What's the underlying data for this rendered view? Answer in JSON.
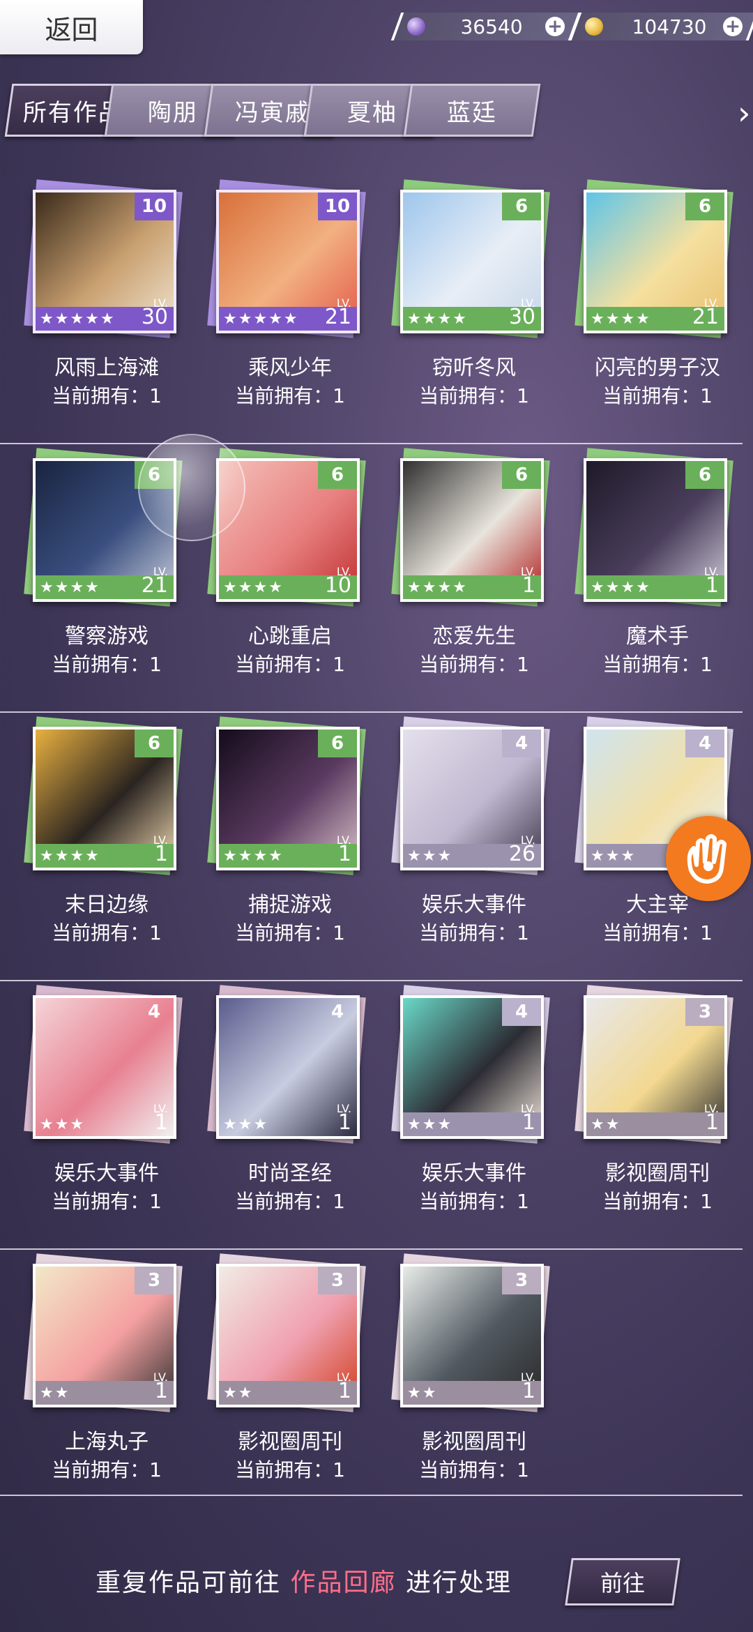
{
  "topbar": {
    "back_label": "返回",
    "gem_value": "36540",
    "coin_value": "104730"
  },
  "tabs": [
    "所有作品",
    "陶朋",
    "冯寅戚",
    "夏柚",
    "蓝廷"
  ],
  "active_tab": 0,
  "cards": [
    {
      "name": "风雨上海滩",
      "owned": "当前拥有：1",
      "count": "10",
      "stars": "★★★★★",
      "lv": "30",
      "tier": "t10",
      "colors": [
        "#3a2a1a",
        "#c9a070",
        "#f0e4d0"
      ]
    },
    {
      "name": "乘风少年",
      "owned": "当前拥有：1",
      "count": "10",
      "stars": "★★★★★",
      "lv": "21",
      "tier": "t10",
      "colors": [
        "#d8703a",
        "#f2b080",
        "#e25a4a"
      ]
    },
    {
      "name": "窃听冬风",
      "owned": "当前拥有：1",
      "count": "6",
      "stars": "★★★★",
      "lv": "30",
      "tier": "t6",
      "colors": [
        "#9ec6ec",
        "#e8eef6",
        "#c6d6e8"
      ]
    },
    {
      "name": "闪亮的男子汉",
      "owned": "当前拥有：1",
      "count": "6",
      "stars": "★★★★",
      "lv": "21",
      "tier": "t6",
      "colors": [
        "#5ec4e8",
        "#f4e0a0",
        "#e8c070"
      ]
    },
    {
      "name": "警察游戏",
      "owned": "当前拥有：1",
      "count": "6",
      "stars": "★★★★",
      "lv": "21",
      "tier": "t6",
      "colors": [
        "#1a2440",
        "#3a4f80",
        "#c8ccd8"
      ]
    },
    {
      "name": "心跳重启",
      "owned": "当前拥有：1",
      "count": "6",
      "stars": "★★★★",
      "lv": "10",
      "tier": "t6",
      "colors": [
        "#f4c0b8",
        "#e88080",
        "#c03030"
      ]
    },
    {
      "name": "恋爱先生",
      "owned": "当前拥有：1",
      "count": "6",
      "stars": "★★★★",
      "lv": "1",
      "tier": "t6",
      "colors": [
        "#303030",
        "#e8e4dc",
        "#b02020"
      ]
    },
    {
      "name": "魔术手",
      "owned": "当前拥有：1",
      "count": "6",
      "stars": "★★★★",
      "lv": "1",
      "tier": "t6",
      "colors": [
        "#1e1a28",
        "#4a3e5c",
        "#d0ccd8"
      ]
    },
    {
      "name": "末日边缘",
      "owned": "当前拥有：1",
      "count": "6",
      "stars": "★★★★",
      "lv": "1",
      "tier": "t6",
      "colors": [
        "#e8b040",
        "#2a2420",
        "#f0d8b0"
      ]
    },
    {
      "name": "捕捉游戏",
      "owned": "当前拥有：1",
      "count": "6",
      "stars": "★★★★",
      "lv": "1",
      "tier": "t6",
      "colors": [
        "#140c1c",
        "#5a3a60",
        "#d8c0c8"
      ]
    },
    {
      "name": "娱乐大事件",
      "owned": "当前拥有：1",
      "count": "4",
      "stars": "★★★",
      "lv": "26",
      "tier": "t4",
      "colors": [
        "#e4e0ec",
        "#c0b8d0",
        "#40384c"
      ]
    },
    {
      "name": "大主宰",
      "owned": "当前拥有：1",
      "count": "4",
      "stars": "★★★",
      "lv": "",
      "tier": "t4",
      "colors": [
        "#cfe4f0",
        "#f2e0a8",
        "#e8eef4"
      ]
    },
    {
      "name": "娱乐大事件",
      "owned": "当前拥有：1",
      "count": "4",
      "stars": "★★★",
      "lv": "1",
      "tier": "t4b",
      "colors": [
        "#f4d4d8",
        "#e88090",
        "#f0f0f0"
      ]
    },
    {
      "name": "时尚圣经",
      "owned": "当前拥有：1",
      "count": "4",
      "stars": "★★★",
      "lv": "1",
      "tier": "t4b",
      "colors": [
        "#5a5c8c",
        "#c8cce0",
        "#2a2a40"
      ]
    },
    {
      "name": "娱乐大事件",
      "owned": "当前拥有：1",
      "count": "4",
      "stars": "★★★",
      "lv": "1",
      "tier": "t4",
      "colors": [
        "#6ad8c8",
        "#2c2c34",
        "#f0e4d8"
      ]
    },
    {
      "name": "影视圈周刊",
      "owned": "当前拥有：1",
      "count": "3",
      "stars": "★★",
      "lv": "1",
      "tier": "t3",
      "colors": [
        "#e8e8ec",
        "#f2d890",
        "#303030"
      ]
    },
    {
      "name": "上海丸子",
      "owned": "当前拥有：1",
      "count": "3",
      "stars": "★★",
      "lv": "1",
      "tier": "t3",
      "colors": [
        "#f2e8c8",
        "#f4a0a0",
        "#303030"
      ]
    },
    {
      "name": "影视圈周刊",
      "owned": "当前拥有：1",
      "count": "3",
      "stars": "★★",
      "lv": "1",
      "tier": "t3",
      "colors": [
        "#f0ece4",
        "#f0a0b0",
        "#d04020"
      ]
    },
    {
      "name": "影视圈周刊",
      "owned": "当前拥有：1",
      "count": "3",
      "stars": "★★",
      "lv": "1",
      "tier": "t3",
      "colors": [
        "#e8ece8",
        "#505860",
        "#2a2a2a"
      ]
    }
  ],
  "footer": {
    "text_before": "重复作品可前往",
    "highlight": "作品回廊",
    "text_after": "进行处理",
    "go_label": "前往",
    "highlight_color": "#ff6f8a"
  },
  "icons": {
    "gem": "purple-gem-icon",
    "coin": "gold-coin-icon",
    "plus": "plus-icon",
    "tab_next": "chevron-right-icon",
    "assist": "assist-hand-icon"
  }
}
